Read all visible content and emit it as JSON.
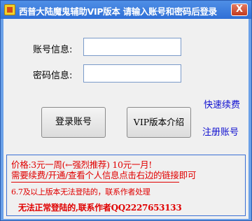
{
  "window": {
    "title": "西普大陆魔鬼辅助VIP版本 请输入账号和密码后登录",
    "close_glyph": "X",
    "icon": "app-icon"
  },
  "form": {
    "account_label": "账号信息:",
    "account_value": "",
    "password_label": "密码信息:",
    "password_value": ""
  },
  "buttons": {
    "login_label": "登录账号",
    "vip_intro_label": "VIP版本介绍"
  },
  "links": {
    "quick_renew": "快速续费",
    "register": "注册账号"
  },
  "info": {
    "price_line": "价格:3元一周(←强烈推荐) 10元一月!",
    "renew_line": "需要续费/开通/查看个人信息点击右边的链接即可",
    "version_line": "6.7及以上版本无法登陆的，联系作者处理",
    "contact_line": "无法正常登陆的,联系作者QQ2227653133"
  },
  "colors": {
    "title_bar": "#2f6fd6",
    "info_text": "#e00000",
    "link_text": "#1010d0"
  }
}
